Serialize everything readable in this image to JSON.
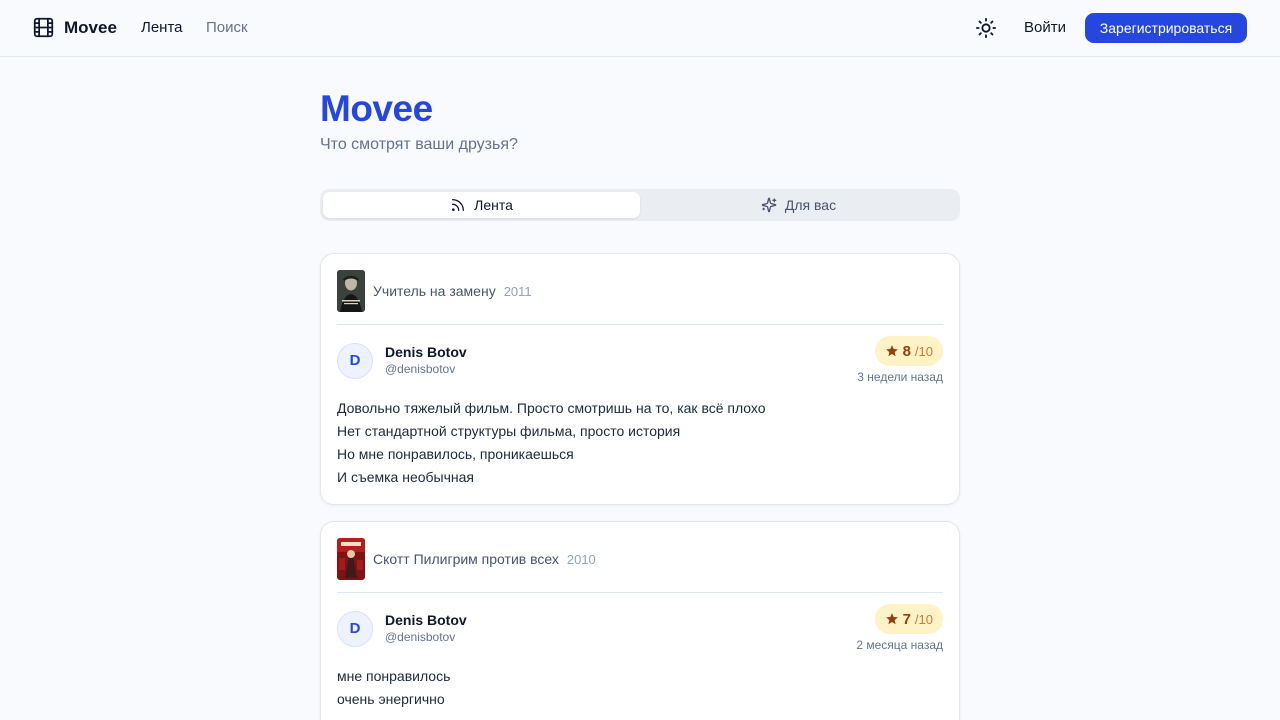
{
  "header": {
    "logo_text": "Movee",
    "nav": [
      {
        "label": "Лента",
        "active": true
      },
      {
        "label": "Поиск",
        "active": false
      }
    ],
    "theme_icon": "sun-icon",
    "login_label": "Войти",
    "signup_label": "Зарегистрироваться"
  },
  "hero": {
    "title": "Movee",
    "subtitle": "Что смотрят ваши друзья?"
  },
  "tabs": [
    {
      "label": "Лента",
      "icon": "rss-icon",
      "active": true
    },
    {
      "label": "Для вас",
      "icon": "sparkles-icon",
      "active": false
    }
  ],
  "feed": [
    {
      "movie": {
        "title": "Учитель на замену",
        "year": "2011"
      },
      "user": {
        "initial": "D",
        "name": "Denis Botov",
        "handle": "@denisbotov"
      },
      "rating": {
        "value": "8",
        "max": "/10"
      },
      "time_ago": "3 недели назад",
      "review_lines": [
        "Довольно тяжелый фильм. Просто смотришь на то, как всё плохо",
        "Нет стандартной структуры фильма, просто история",
        "Но мне понравилось, проникаешься",
        "И съемка необычная"
      ]
    },
    {
      "movie": {
        "title": "Скотт Пилигрим против всех",
        "year": "2010"
      },
      "user": {
        "initial": "D",
        "name": "Denis Botov",
        "handle": "@denisbotov"
      },
      "rating": {
        "value": "7",
        "max": "/10"
      },
      "time_ago": "2 месяца назад",
      "review_lines": [
        "мне понравилось",
        "очень энергично"
      ]
    }
  ],
  "colors": {
    "accent": "#2547e0",
    "rating_bg": "#fef3c7",
    "rating_text": "#92400e",
    "page_bg": "#f8fafd"
  }
}
